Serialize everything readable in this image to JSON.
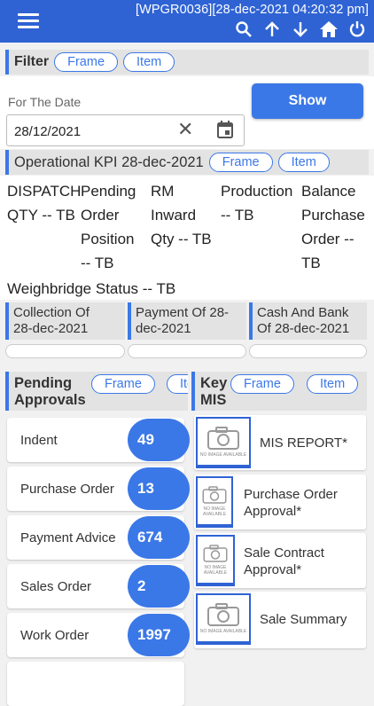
{
  "header": {
    "title": "[WPGR0036][28-dec-2021 04:20:32 pm]",
    "icons": [
      "menu-icon",
      "search-icon",
      "arrow-up-icon",
      "arrow-down-icon",
      "home-icon",
      "power-icon"
    ]
  },
  "filter": {
    "label": "Filter",
    "frame": "Frame",
    "item": "Item",
    "date_label": "For The Date",
    "date_value": "28/12/2021",
    "clear": "✕",
    "show": "Show"
  },
  "kpi": {
    "label": "Operational KPI 28-dec-2021",
    "frame": "Frame",
    "item": "Item",
    "dispatch": [
      "DISPATCH",
      "QTY -- TB"
    ],
    "pending": [
      "Pending",
      "Order",
      "Position",
      "-- TB"
    ],
    "rm": [
      "RM",
      "Inward",
      "Qty -- TB"
    ],
    "production": [
      "Production",
      "-- TB"
    ],
    "balance": [
      "Balance",
      "Purchase",
      "Order --",
      "TB"
    ],
    "weighbridge": "Weighbridge Status -- TB"
  },
  "cards": [
    {
      "line1": "Collection Of",
      "line2": "28-dec-2021"
    },
    {
      "line1": "Payment Of 28-",
      "line2": "dec-2021"
    },
    {
      "line1": "Cash And Bank",
      "line2": "Of 28-dec-2021"
    }
  ],
  "approvals": {
    "label1": "Pending",
    "label2": "Approvals",
    "frame": "Frame",
    "item": "Item",
    "items": [
      {
        "label": "Indent",
        "count": "49"
      },
      {
        "label": "Purchase Order",
        "count": "13"
      },
      {
        "label": "Payment Advice",
        "count": "674"
      },
      {
        "label": "Sales Order",
        "count": "2"
      },
      {
        "label": "Work Order",
        "count": "1997"
      }
    ]
  },
  "keymis": {
    "label1": "Key",
    "label2": "MIS",
    "frame": "Frame",
    "item": "Item",
    "no_image": "NO IMAGE AVAILABLE",
    "items": [
      {
        "line1": "MIS REPORT*",
        "line2": ""
      },
      {
        "line1": "Purchase Order",
        "line2": "Approval*"
      },
      {
        "line1": "Sale Contract",
        "line2": "Approval*"
      },
      {
        "line1": "Sale Summary",
        "line2": ""
      }
    ]
  },
  "colors": {
    "accent": "#3b78e7",
    "topbar": "#2f63d4",
    "header_bg": "#e3e3e3"
  }
}
